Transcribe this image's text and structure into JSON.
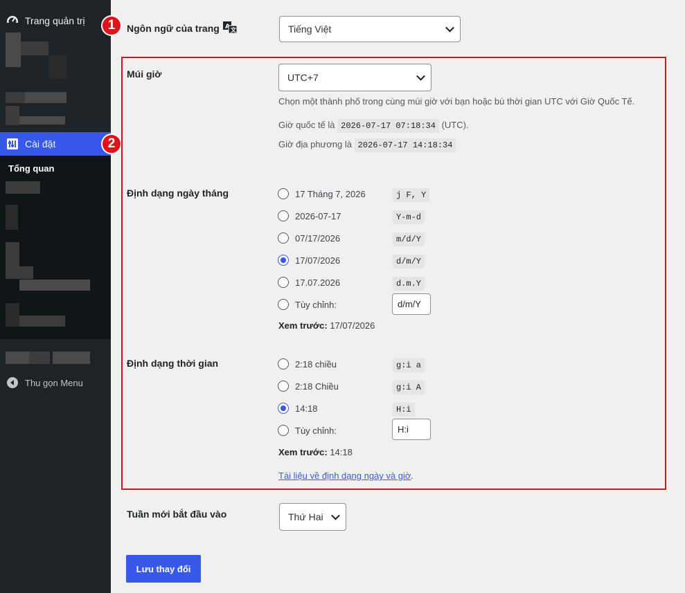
{
  "sidebar": {
    "dashboard_label": "Trang quản trị",
    "settings_label": "Cài đặt",
    "submenu_overview": "Tổng quan",
    "collapse_label": "Thu gọn Menu"
  },
  "badges": {
    "one": "1",
    "two": "2"
  },
  "language": {
    "label": "Ngôn ngữ của trang",
    "value": "Tiếng Việt"
  },
  "timezone": {
    "label": "Múi giờ",
    "value": "UTC+7",
    "description": "Chọn một thành phố trong cùng múi giờ với bạn hoặc bù thời gian UTC với Giờ Quốc Tế.",
    "utc_prefix": "Giờ quốc tế là",
    "utc_time": "2026-07-17 07:18:34",
    "utc_suffix": "(UTC).",
    "local_prefix": "Giờ địa phương là",
    "local_time": "2026-07-17 14:18:34"
  },
  "date_format": {
    "label": "Định dạng ngày tháng",
    "options": [
      {
        "label": "17 Tháng 7, 2026",
        "format": "j F, Y",
        "checked": false
      },
      {
        "label": "2026-07-17",
        "format": "Y-m-d",
        "checked": false
      },
      {
        "label": "07/17/2026",
        "format": "m/d/Y",
        "checked": false
      },
      {
        "label": "17/07/2026",
        "format": "d/m/Y",
        "checked": true
      },
      {
        "label": "17.07.2026",
        "format": "d.m.Y",
        "checked": false
      }
    ],
    "custom_label": "Tùy chỉnh:",
    "custom_value": "d/m/Y",
    "preview_label": "Xem trước:",
    "preview_value": "17/07/2026"
  },
  "time_format": {
    "label": "Định dạng thời gian",
    "options": [
      {
        "label": "2:18 chiều",
        "format": "g:i a",
        "checked": false
      },
      {
        "label": "2:18 Chiều",
        "format": "g:i A",
        "checked": false
      },
      {
        "label": "14:18",
        "format": "H:i",
        "checked": true
      }
    ],
    "custom_label": "Tùy chỉnh:",
    "custom_value": "H:i",
    "preview_label": "Xem trước:",
    "preview_value": "14:18",
    "doc_link": "Tài liệu về định dạng ngày và giờ"
  },
  "week_start": {
    "label": "Tuần mới bắt đầu vào",
    "value": "Thứ Hai"
  },
  "save_button": "Lưu thay đổi",
  "colors": {
    "accent": "#3858e9",
    "highlight_box": "#d4131b",
    "sidebar": "#1d2327"
  }
}
